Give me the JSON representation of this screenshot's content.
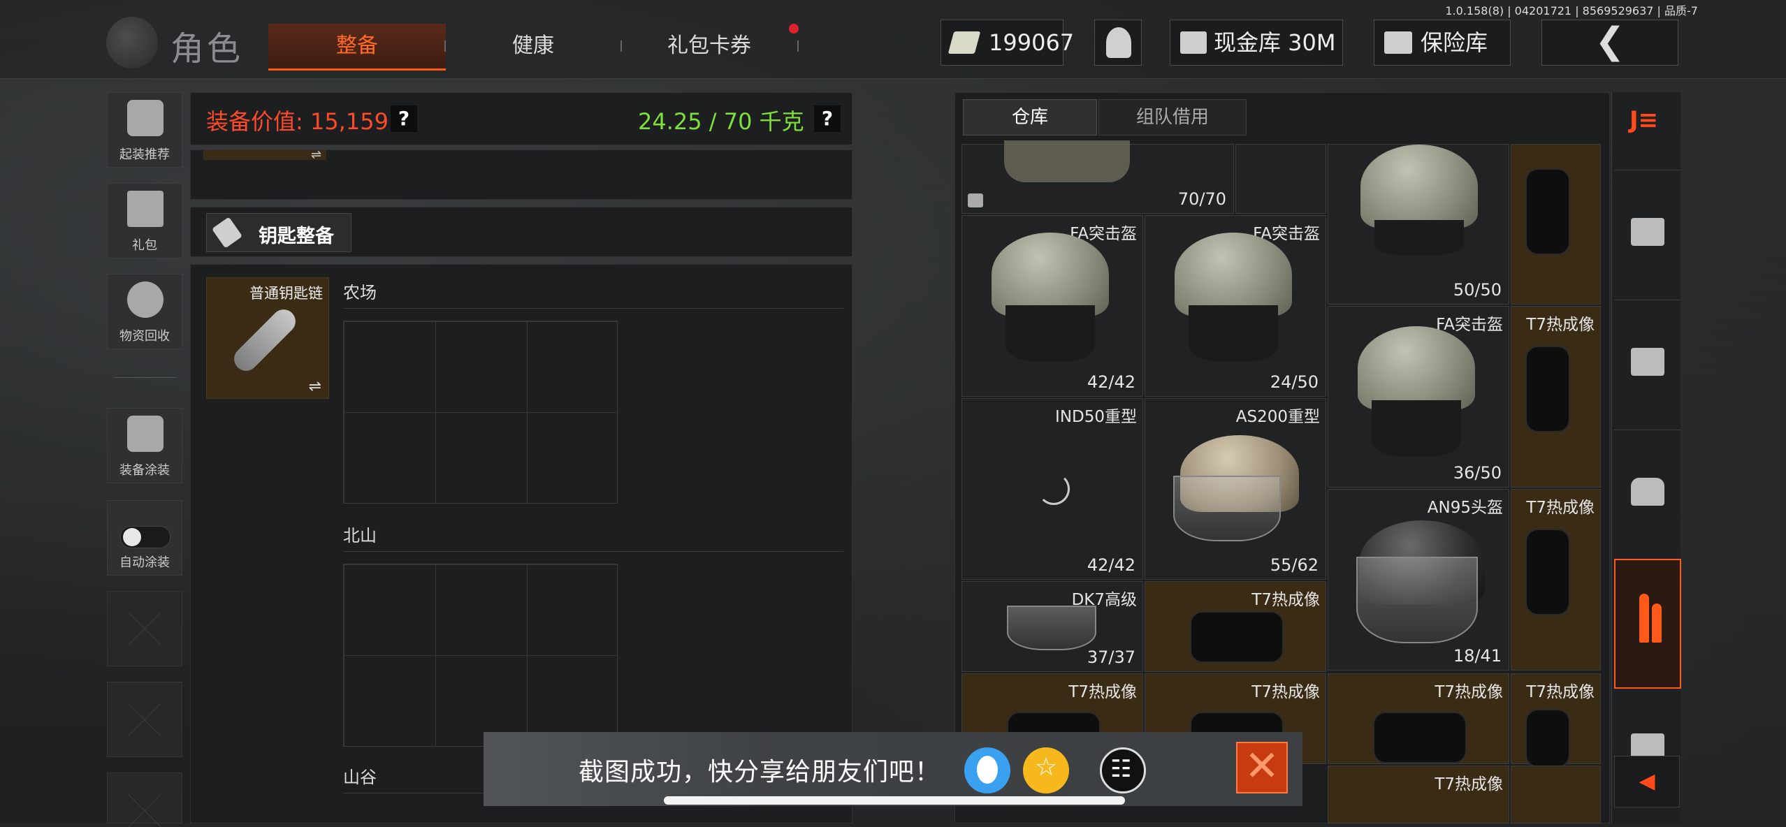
{
  "version_text": "1.0.158(8) | 04201721 | 8569529637 | 品质-7",
  "header": {
    "title": "角色",
    "tabs": [
      {
        "label": "整备",
        "active": true
      },
      {
        "label": "健康",
        "active": false
      },
      {
        "label": "礼包卡券",
        "active": false,
        "notification": true
      }
    ],
    "currency": "199067",
    "cash_vault_label": "现金库 30M",
    "safe_label": "保险库"
  },
  "sidebar": {
    "items": [
      {
        "label": "起装推荐",
        "icon": "helmet-grid-icon"
      },
      {
        "label": "礼包",
        "icon": "gift-icon"
      },
      {
        "label": "物资回收",
        "icon": "recycle-icon"
      },
      {
        "label": "装备涂装",
        "icon": "paint-helmet-icon"
      },
      {
        "label": "自动涂装",
        "icon": "toggle-icon"
      }
    ]
  },
  "loadout": {
    "value_label": "装备价值: 15,159",
    "weight_label": "24.25 / 70 千克",
    "help": "?",
    "key_section_label": "钥匙整备",
    "keychain_label": "普通钥匙链",
    "swap_icon": "⇌",
    "zones": [
      "农场",
      "北山",
      "山谷"
    ]
  },
  "inventory": {
    "tabs": [
      {
        "label": "仓库",
        "active": true
      },
      {
        "label": "组队借用",
        "active": false
      }
    ],
    "items": [
      {
        "name": "",
        "count": "70/70"
      },
      {
        "name": "",
        "count": "50/50"
      },
      {
        "name": "FA突击盔",
        "count": "42/42"
      },
      {
        "name": "FA突击盔",
        "count": "24/50"
      },
      {
        "name": "FA突击盔",
        "count": "36/50"
      },
      {
        "name": "T7热成像",
        "count": ""
      },
      {
        "name": "IND50重型",
        "count": "42/42"
      },
      {
        "name": "AS200重型",
        "count": "55/62"
      },
      {
        "name": "AN95头盔",
        "count": "18/41"
      },
      {
        "name": "T7热成像",
        "count": ""
      },
      {
        "name": "DK7高级",
        "count": "37/37"
      },
      {
        "name": "T7热成像",
        "count": ""
      },
      {
        "name": "T7热成像",
        "count": ""
      },
      {
        "name": "T7热成像",
        "count": ""
      },
      {
        "name": "T7热成像",
        "count": ""
      },
      {
        "name": "T7热成像",
        "count": ""
      },
      {
        "name": "T7热成像",
        "count": ""
      }
    ]
  },
  "share_banner": {
    "text": "截图成功，快分享给朋友们吧！",
    "close": "✕"
  },
  "colors": {
    "accent": "#ff5a1a",
    "value_red": "#ff4a2a",
    "weight_green": "#7fe03a",
    "gold_cell": "#3a2c14"
  }
}
